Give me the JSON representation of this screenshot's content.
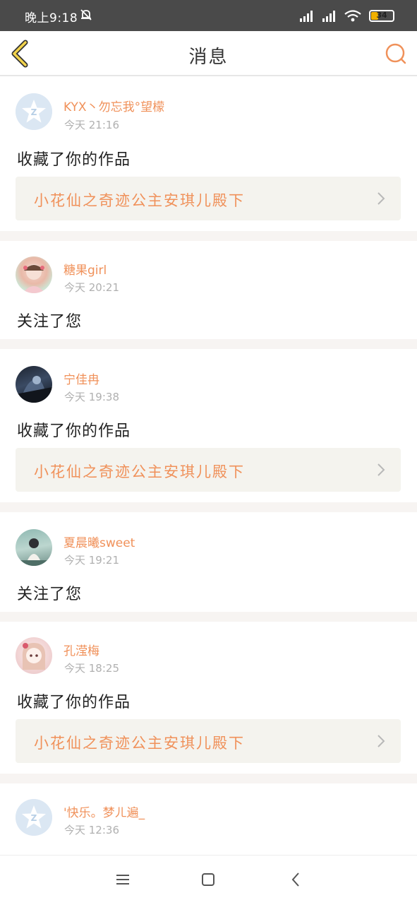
{
  "status": {
    "time": "晚上9:18",
    "battery": "34",
    "battery_fill": 0.34
  },
  "header": {
    "title": "消息"
  },
  "feed": [
    {
      "name": "KYX丶勿忘我°望檬",
      "time": "今天 21:16",
      "action": "收藏了你的作品",
      "work": "小花仙之奇迹公主安琪儿殿下",
      "avatar": "default-avatar-icon"
    },
    {
      "name": "糖果girl",
      "time": "今天 20:21",
      "action": "关注了您",
      "avatar": "photo-avatar"
    },
    {
      "name": "宁佳冉",
      "time": "今天 19:38",
      "action": "收藏了你的作品",
      "work": "小花仙之奇迹公主安琪儿殿下",
      "avatar": "photo-avatar"
    },
    {
      "name": "夏晨曦sweet",
      "time": "今天 19:21",
      "action": "关注了您",
      "avatar": "photo-avatar"
    },
    {
      "name": "孔滢梅",
      "time": "今天 18:25",
      "action": "收藏了你的作品",
      "work": "小花仙之奇迹公主安琪儿殿下",
      "avatar": "photo-avatar"
    },
    {
      "name": "'快乐。梦ㄦ遍_",
      "time": "今天 12:36",
      "avatar": "default-avatar-icon"
    }
  ],
  "colors": {
    "accent": "#f0915a",
    "statusbar": "#4a4a4a",
    "work_bg": "#f4f3ee",
    "divider": "#f7f4f2"
  },
  "icons": {
    "back": "back-chevron-icon",
    "search": "search-icon",
    "menu": "menu-icon",
    "home": "home-square-icon",
    "nav_back": "nav-back-icon"
  }
}
